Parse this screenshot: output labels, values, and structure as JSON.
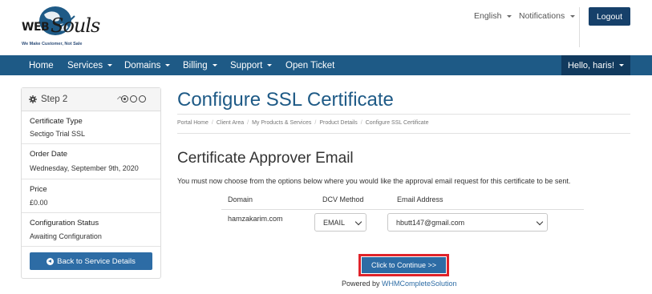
{
  "brand": {
    "logo_web": "WEB",
    "logo_souls": "Souls",
    "tagline": "We Make Customer, Not Sale"
  },
  "header": {
    "language": "English",
    "notifications": "Notifications",
    "logout": "Logout"
  },
  "nav": {
    "items": [
      "Home",
      "Services",
      "Domains",
      "Billing",
      "Support",
      "Open Ticket"
    ],
    "user": "Hello, haris!"
  },
  "sidebar": {
    "step": "Step 2",
    "rows": [
      {
        "label": "Certificate Type",
        "value": "Sectigo Trial SSL"
      },
      {
        "label": "Order Date",
        "value": "Wednesday, September 9th, 2020"
      },
      {
        "label": "Price",
        "value": "£0.00"
      },
      {
        "label": "Configuration Status",
        "value": "Awaiting Configuration"
      }
    ],
    "back_button": "Back to Service Details"
  },
  "main": {
    "title": "Configure SSL Certificate",
    "breadcrumb": [
      "Portal Home",
      "Client Area",
      "My Products & Services",
      "Product Details",
      "Configure SSL Certificate"
    ],
    "section_title": "Certificate Approver Email",
    "description": "You must now choose from the options below where you would like the approval email request for this certificate to be sent.",
    "table": {
      "headers": [
        "Domain",
        "DCV Method",
        "Email Address"
      ],
      "row": {
        "domain": "hamzakarim.com",
        "dcv_method": "EMAIL",
        "email": "hbutt147@gmail.com"
      }
    },
    "continue_button": "Click to Continue >>",
    "powered_prefix": "Powered by ",
    "powered_link": "WHMCompleteSolution"
  },
  "colors": {
    "primary": "#1e5a86",
    "button": "#2d6ca5",
    "highlight": "#e0232a"
  }
}
